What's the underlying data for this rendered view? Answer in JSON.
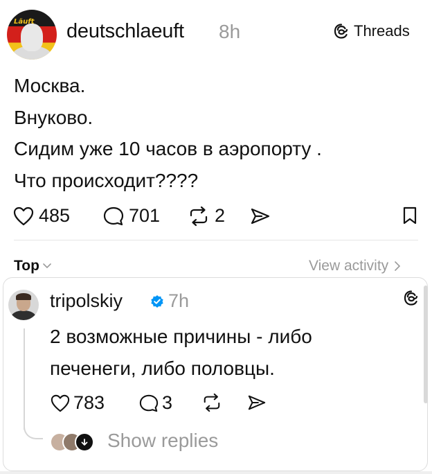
{
  "post": {
    "username": "deutschlaeuft",
    "time": "8h",
    "avatar_text": "Läuft",
    "threads_label": "Threads",
    "lines": [
      "Москва.",
      "Внуково.",
      "Сидим уже 10 часов в аэропорту .",
      "Что происходит????"
    ],
    "likes": "485",
    "comments": "701",
    "reposts": "2"
  },
  "sort": {
    "label": "Top",
    "view_activity": "View activity"
  },
  "reply": {
    "username": "tripolskiy",
    "time": "7h",
    "lines": [
      "2 возможные причины - либо",
      "печенеги, либо половцы."
    ],
    "likes": "783",
    "comments": "3",
    "show_replies": "Show replies"
  },
  "icons": {
    "like": "heart-icon",
    "comment": "comment-bubble-icon",
    "repost": "repost-icon",
    "share": "send-icon",
    "bookmark": "bookmark-icon",
    "threads": "threads-logo-icon",
    "verified": "verified-badge-icon",
    "chevron": "chevron-down-icon",
    "chevron_right": "chevron-right-icon"
  },
  "colors": {
    "text": "#111111",
    "muted": "#9a9a9a",
    "verified": "#0095f6"
  }
}
